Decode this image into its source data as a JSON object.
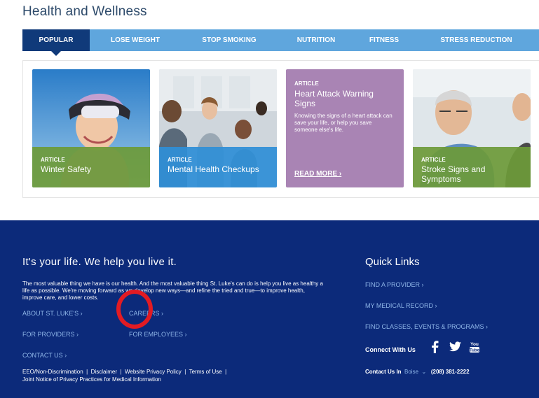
{
  "section_title": "Health and Wellness",
  "tabs": [
    {
      "label": "POPULAR"
    },
    {
      "label": "LOSE WEIGHT"
    },
    {
      "label": "STOP SMOKING"
    },
    {
      "label": "NUTRITION"
    },
    {
      "label": "FITNESS"
    },
    {
      "label": "STRESS REDUCTION"
    }
  ],
  "cards": [
    {
      "kind": "ARTICLE",
      "title": "Winter Safety",
      "caption_color": "#6d9a38"
    },
    {
      "kind": "ARTICLE",
      "title": "Mental Health Checkups",
      "caption_color": "#2f8fd6"
    },
    {
      "kind": "ARTICLE",
      "title": "Heart Attack Warning Signs",
      "desc": "Knowing the signs of a heart attack can save your life, or help you save someone else's life.",
      "more": "READ MORE ›",
      "bg_color": "#a984b4"
    },
    {
      "kind": "ARTICLE",
      "title": "Stroke Signs and Symptoms",
      "caption_color": "#6d9a38"
    }
  ],
  "footer": {
    "headline": "It's your life. We help you live it.",
    "blurb": "The most valuable thing we have is our health. And the most valuable thing St. Luke's can do is help you live as healthy a life as possible. We're moving forward as we develop new ways—and refine the tried and true—to improve health, improve care, and lower costs.",
    "links": [
      "ABOUT ST. LUKE'S ›",
      "CAREERS ›",
      "FOR PROVIDERS ›",
      "FOR EMPLOYEES ›",
      "CONTACT US ›"
    ],
    "legal": [
      "EEO/Non-Discrimination",
      "Disclaimer",
      "Website Privacy Policy",
      "Terms of Use",
      "Joint Notice of Privacy Practices for Medical Information"
    ],
    "quick_links_title": "Quick Links",
    "quick_links": [
      "FIND A PROVIDER ›",
      "MY MEDICAL RECORD ›",
      "FIND CLASSES, EVENTS & PROGRAMS ›"
    ],
    "connect_label": "Connect With Us",
    "social_icons": [
      "facebook-icon",
      "twitter-icon",
      "youtube-icon"
    ],
    "contact_label": "Contact Us In",
    "contact_city": "Boise",
    "contact_phone": "(208) 381-2222"
  },
  "colors": {
    "tab_bar": "#5fa6dd",
    "tab_active": "#103a7a",
    "footer_bg": "#0c2a7a",
    "footer_link": "#8fb6e8",
    "highlight_ring": "#e21b23"
  }
}
